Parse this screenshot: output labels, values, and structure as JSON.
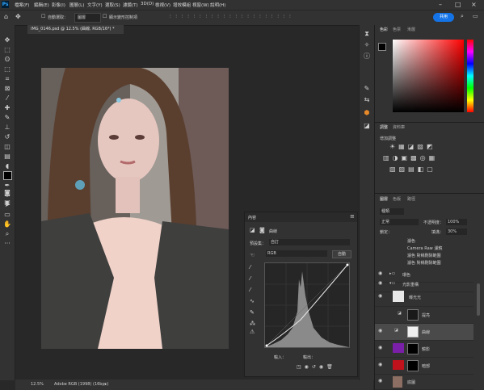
{
  "menu": {
    "items": [
      "檔案(F)",
      "編輯(E)",
      "影像(I)",
      "圖層(L)",
      "文字(Y)",
      "選取(S)",
      "濾鏡(T)",
      "3D(D)",
      "檢視(V)",
      "增效模組",
      "視窗(W)",
      "說明(H)"
    ]
  },
  "options": {
    "auto_select_label": "自動選取：",
    "auto_select_value": "圖層",
    "transform_label": "顯示變形控制項",
    "share_label": "共用"
  },
  "document": {
    "tab_title": "IMG_0146.psd @ 12.5% (曲線, RGB/16*) *",
    "zoom": "12.5%",
    "profile": "Adobe RGB (1998) (16bpc)"
  },
  "color_panel": {
    "tabs": [
      "色彩",
      "色票",
      "漸層"
    ]
  },
  "adjust_panel": {
    "tabs": [
      "調整",
      "資料庫"
    ],
    "add_label": "增加調整"
  },
  "layers_panel": {
    "tabs": [
      "圖層",
      "色版",
      "路徑"
    ],
    "kind_label": "種類",
    "blend_mode": "正常",
    "opacity_label": "不透明度：",
    "opacity_value": "100%",
    "lock_label": "鎖定：",
    "fill_label": "填滿：",
    "fill_value": "30%",
    "filters": [
      "濾色",
      "Camera Raw 濾鏡",
      "濾色 對稱刪除範圍",
      "濾色 對稱刪除範圍"
    ],
    "layers": [
      {
        "name": "環色",
        "type": "group"
      },
      {
        "name": "光影重構",
        "type": "group"
      },
      {
        "name": "曝光光",
        "type": "pixel"
      },
      {
        "name": "提亮",
        "type": "adjust"
      },
      {
        "name": "曲線",
        "type": "adjust"
      },
      {
        "name": "鏡影",
        "type": "fill"
      },
      {
        "name": "暗部",
        "type": "fill"
      },
      {
        "name": "底圖",
        "type": "pixel"
      }
    ],
    "colors": {
      "purple": "#7a1fa8",
      "red": "#c0121c"
    }
  },
  "properties": {
    "title": "內容",
    "tab": "曲線",
    "preset_label": "預設集：",
    "preset_value": "自訂",
    "channel": "RGB",
    "auto_label": "自動",
    "input_label": "輸入：",
    "output_label": "輸出："
  }
}
